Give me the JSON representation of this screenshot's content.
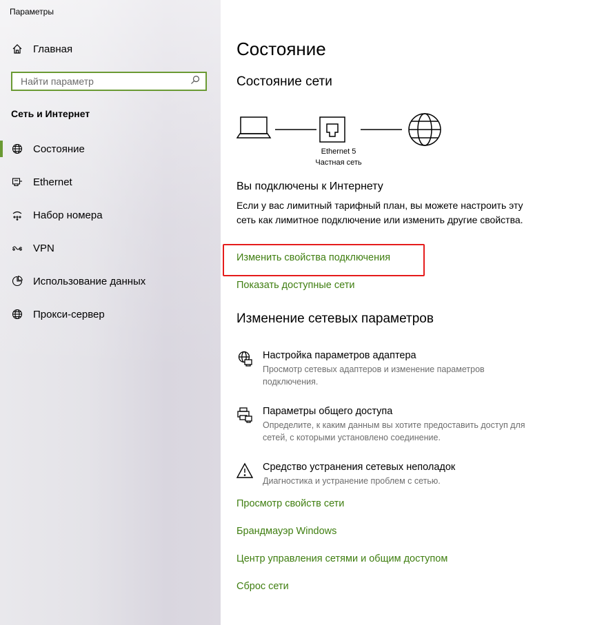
{
  "window": {
    "title": "Параметры"
  },
  "sidebar": {
    "home_label": "Главная",
    "search_placeholder": "Найти параметр",
    "section_title": "Сеть и Интернет",
    "items": [
      {
        "label": "Состояние",
        "icon": "globe-icon",
        "active": true
      },
      {
        "label": "Ethernet",
        "icon": "ethernet-icon",
        "active": false
      },
      {
        "label": "Набор номера",
        "icon": "dialup-icon",
        "active": false
      },
      {
        "label": "VPN",
        "icon": "vpn-icon",
        "active": false
      },
      {
        "label": "Использование данных",
        "icon": "data-usage-icon",
        "active": false
      },
      {
        "label": "Прокси-сервер",
        "icon": "globe-icon",
        "active": false
      }
    ]
  },
  "main": {
    "title": "Состояние",
    "network_status_heading": "Состояние сети",
    "connection": {
      "adapter": "Ethernet 5",
      "profile": "Частная сеть"
    },
    "connected_title": "Вы подключены к Интернету",
    "connected_desc": "Если у вас лимитный тарифный план, вы можете настроить эту сеть как лимитное подключение или изменить другие свойства.",
    "link_change_properties": "Изменить свойства подключения",
    "link_show_networks": "Показать доступные сети",
    "change_settings_heading": "Изменение сетевых параметров",
    "settings": [
      {
        "title": "Настройка параметров адаптера",
        "desc": "Просмотр сетевых адаптеров и изменение параметров подключения.",
        "icon": "adapter-icon"
      },
      {
        "title": "Параметры общего доступа",
        "desc": "Определите, к каким данным вы хотите предоставить доступ для сетей, с которыми установлено соединение.",
        "icon": "sharing-icon"
      },
      {
        "title": "Средство устранения сетевых неполадок",
        "desc": "Диагностика и устранение проблем с сетью.",
        "icon": "warning-icon"
      }
    ],
    "links": [
      "Просмотр свойств сети",
      "Брандмауэр Windows",
      "Центр управления сетями и общим доступом",
      "Сброс сети"
    ]
  },
  "colors": {
    "accent": "#6a9a33",
    "link": "#3f7e10",
    "highlight": "#e51b1b"
  }
}
